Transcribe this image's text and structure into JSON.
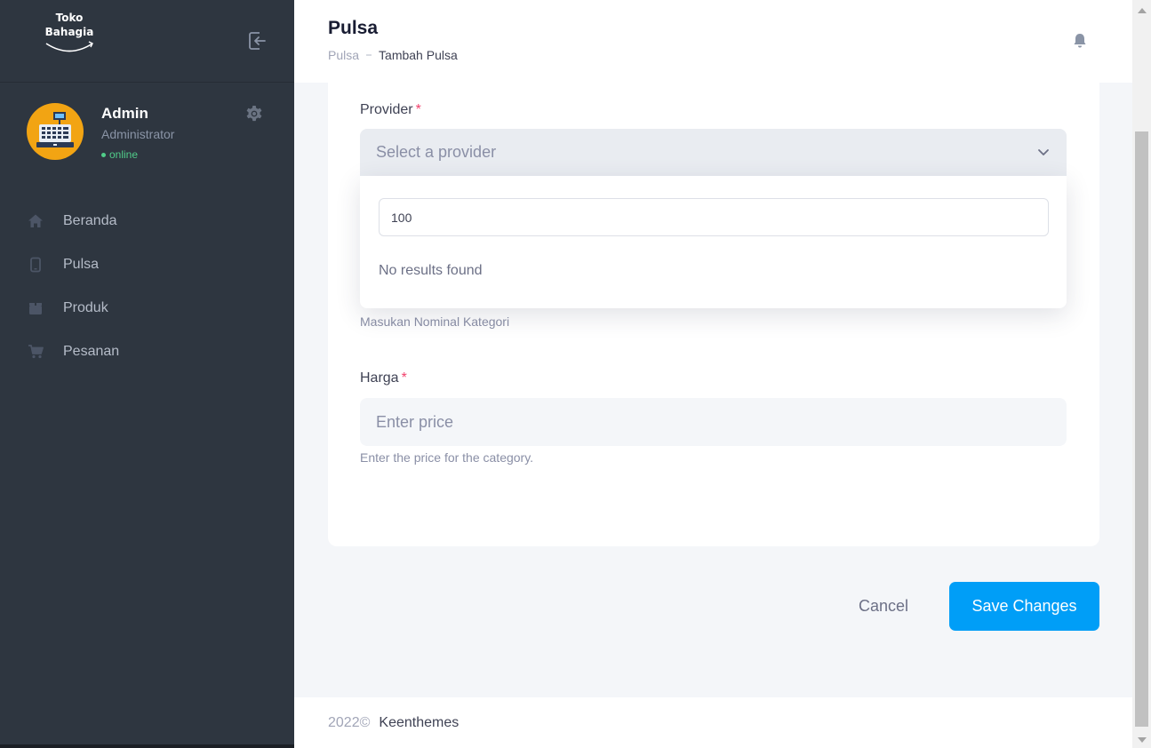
{
  "app": {
    "logo_line1": "Toko",
    "logo_line2": "Bahagia"
  },
  "user": {
    "name": "Admin",
    "role": "Administrator",
    "status": "online"
  },
  "sidebar": {
    "items": [
      {
        "label": "Beranda",
        "icon": "home-icon"
      },
      {
        "label": "Pulsa",
        "icon": "phone-icon"
      },
      {
        "label": "Produk",
        "icon": "box-icon"
      },
      {
        "label": "Pesanan",
        "icon": "cart-icon"
      }
    ]
  },
  "header": {
    "title": "Pulsa",
    "breadcrumb": [
      "Pulsa",
      "Tambah Pulsa"
    ]
  },
  "form": {
    "provider": {
      "label": "Provider",
      "required_mark": "*",
      "placeholder": "Select a provider",
      "search_value": "100",
      "empty_text": "No results found"
    },
    "nominal_helper": "Masukan Nominal Kategori",
    "price": {
      "label": "Harga",
      "required_mark": "*",
      "placeholder": "Enter price",
      "helper": "Enter the price for the category."
    }
  },
  "actions": {
    "cancel_label": "Cancel",
    "save_label": "Save Changes"
  },
  "footer": {
    "year": "2022©",
    "link": "Keenthemes"
  },
  "colors": {
    "sidebar_bg": "#2e3640",
    "primary": "#009ef7",
    "danger": "#f1416c",
    "success": "#50cd89"
  }
}
